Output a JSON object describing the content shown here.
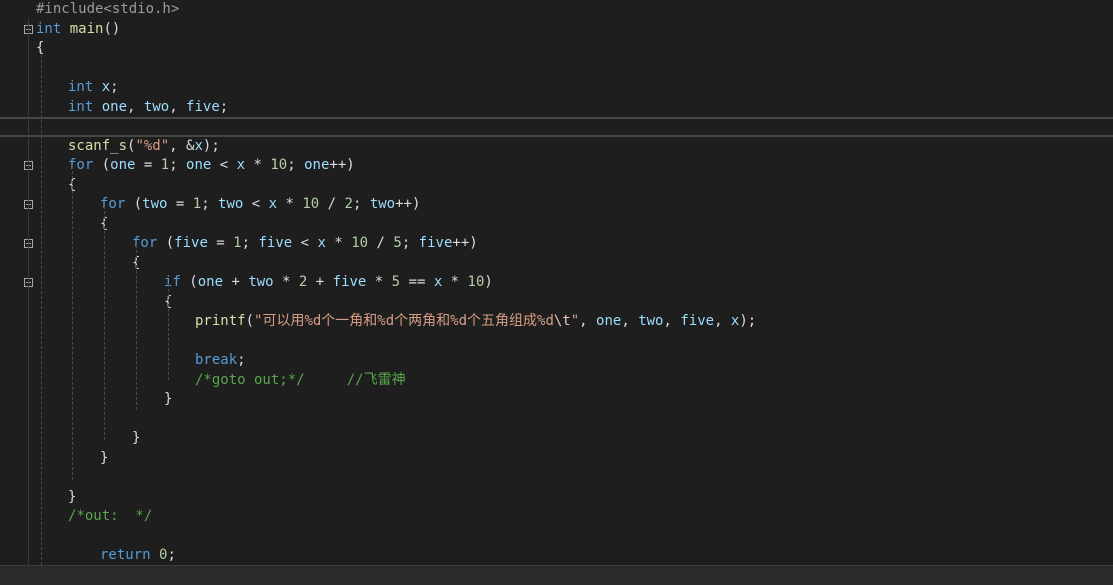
{
  "editor": {
    "lines": [
      {
        "fold": false,
        "indent": 36,
        "tokens": [
          {
            "t": "#include<stdio.h>",
            "c": "pp"
          }
        ]
      },
      {
        "fold": true,
        "indent": 36,
        "tokens": [
          {
            "t": "int",
            "c": "kw"
          },
          {
            "t": " "
          },
          {
            "t": "main",
            "c": "fn"
          },
          {
            "t": "()"
          }
        ]
      },
      {
        "fold": false,
        "indent": 36,
        "tokens": [
          {
            "t": "{"
          }
        ]
      },
      {
        "fold": false,
        "indent": 68,
        "tokens": []
      },
      {
        "fold": false,
        "indent": 68,
        "tokens": [
          {
            "t": "int",
            "c": "kw"
          },
          {
            "t": " "
          },
          {
            "t": "x",
            "c": "id"
          },
          {
            "t": ";"
          }
        ]
      },
      {
        "fold": false,
        "indent": 68,
        "tokens": [
          {
            "t": "int",
            "c": "kw"
          },
          {
            "t": " "
          },
          {
            "t": "one",
            "c": "id"
          },
          {
            "t": ", "
          },
          {
            "t": "two",
            "c": "id"
          },
          {
            "t": ", "
          },
          {
            "t": "five",
            "c": "id"
          },
          {
            "t": ";"
          }
        ]
      },
      {
        "fold": false,
        "indent": 68,
        "current": true,
        "tokens": []
      },
      {
        "fold": false,
        "indent": 68,
        "tokens": [
          {
            "t": "scanf_s",
            "c": "fn"
          },
          {
            "t": "("
          },
          {
            "t": "\"%d\"",
            "c": "str"
          },
          {
            "t": ", &"
          },
          {
            "t": "x",
            "c": "id"
          },
          {
            "t": ");"
          }
        ]
      },
      {
        "fold": true,
        "indent": 68,
        "tokens": [
          {
            "t": "for",
            "c": "kw"
          },
          {
            "t": " ("
          },
          {
            "t": "one",
            "c": "id"
          },
          {
            "t": " = "
          },
          {
            "t": "1",
            "c": "num"
          },
          {
            "t": "; "
          },
          {
            "t": "one",
            "c": "id"
          },
          {
            "t": " < "
          },
          {
            "t": "x",
            "c": "id"
          },
          {
            "t": " * "
          },
          {
            "t": "10",
            "c": "num"
          },
          {
            "t": "; "
          },
          {
            "t": "one",
            "c": "id"
          },
          {
            "t": "++)"
          }
        ]
      },
      {
        "fold": false,
        "indent": 68,
        "tokens": [
          {
            "t": "{"
          }
        ]
      },
      {
        "fold": true,
        "indent": 100,
        "tokens": [
          {
            "t": "for",
            "c": "kw"
          },
          {
            "t": " ("
          },
          {
            "t": "two",
            "c": "id"
          },
          {
            "t": " = "
          },
          {
            "t": "1",
            "c": "num"
          },
          {
            "t": "; "
          },
          {
            "t": "two",
            "c": "id"
          },
          {
            "t": " < "
          },
          {
            "t": "x",
            "c": "id"
          },
          {
            "t": " * "
          },
          {
            "t": "10",
            "c": "num"
          },
          {
            "t": " / "
          },
          {
            "t": "2",
            "c": "num"
          },
          {
            "t": "; "
          },
          {
            "t": "two",
            "c": "id"
          },
          {
            "t": "++)"
          }
        ]
      },
      {
        "fold": false,
        "indent": 100,
        "tokens": [
          {
            "t": "{"
          }
        ]
      },
      {
        "fold": true,
        "indent": 132,
        "tokens": [
          {
            "t": "for",
            "c": "kw"
          },
          {
            "t": " ("
          },
          {
            "t": "five",
            "c": "id"
          },
          {
            "t": " = "
          },
          {
            "t": "1",
            "c": "num"
          },
          {
            "t": "; "
          },
          {
            "t": "five",
            "c": "id"
          },
          {
            "t": " < "
          },
          {
            "t": "x",
            "c": "id"
          },
          {
            "t": " * "
          },
          {
            "t": "10",
            "c": "num"
          },
          {
            "t": " / "
          },
          {
            "t": "5",
            "c": "num"
          },
          {
            "t": "; "
          },
          {
            "t": "five",
            "c": "id"
          },
          {
            "t": "++)"
          }
        ]
      },
      {
        "fold": false,
        "indent": 132,
        "tokens": [
          {
            "t": "{"
          }
        ]
      },
      {
        "fold": true,
        "indent": 164,
        "tokens": [
          {
            "t": "if",
            "c": "kw"
          },
          {
            "t": " ("
          },
          {
            "t": "one",
            "c": "id"
          },
          {
            "t": " + "
          },
          {
            "t": "two",
            "c": "id"
          },
          {
            "t": " * "
          },
          {
            "t": "2",
            "c": "num"
          },
          {
            "t": " + "
          },
          {
            "t": "five",
            "c": "id"
          },
          {
            "t": " * "
          },
          {
            "t": "5",
            "c": "num"
          },
          {
            "t": " == "
          },
          {
            "t": "x",
            "c": "id"
          },
          {
            "t": " * "
          },
          {
            "t": "10",
            "c": "num"
          },
          {
            "t": ")"
          }
        ]
      },
      {
        "fold": false,
        "indent": 164,
        "tokens": [
          {
            "t": "{"
          }
        ]
      },
      {
        "fold": false,
        "indent": 195,
        "tokens": [
          {
            "t": "printf",
            "c": "fn"
          },
          {
            "t": "("
          },
          {
            "t": "\"可以用%d个一角和%d个两角和%d个五角组成%d",
            "c": "str"
          },
          {
            "t": "\\t",
            "c": "esc"
          },
          {
            "t": "\"",
            "c": "str"
          },
          {
            "t": ", "
          },
          {
            "t": "one",
            "c": "id"
          },
          {
            "t": ", "
          },
          {
            "t": "two",
            "c": "id"
          },
          {
            "t": ", "
          },
          {
            "t": "five",
            "c": "id"
          },
          {
            "t": ", "
          },
          {
            "t": "x",
            "c": "id"
          },
          {
            "t": ");"
          }
        ]
      },
      {
        "fold": false,
        "indent": 195,
        "tokens": []
      },
      {
        "fold": false,
        "indent": 195,
        "tokens": [
          {
            "t": "break",
            "c": "kw"
          },
          {
            "t": ";"
          }
        ]
      },
      {
        "fold": false,
        "indent": 195,
        "tokens": [
          {
            "t": "/*goto out;*/     //飞雷神",
            "c": "cm"
          }
        ]
      },
      {
        "fold": false,
        "indent": 164,
        "tokens": [
          {
            "t": "}"
          }
        ]
      },
      {
        "fold": false,
        "indent": 164,
        "tokens": []
      },
      {
        "fold": false,
        "indent": 132,
        "tokens": [
          {
            "t": "}"
          }
        ]
      },
      {
        "fold": false,
        "indent": 100,
        "tokens": [
          {
            "t": "}"
          }
        ]
      },
      {
        "fold": false,
        "indent": 100,
        "tokens": []
      },
      {
        "fold": false,
        "indent": 68,
        "tokens": [
          {
            "t": "}"
          }
        ]
      },
      {
        "fold": false,
        "indent": 68,
        "tokens": [
          {
            "t": "/*out:  */",
            "c": "cm"
          }
        ]
      },
      {
        "fold": false,
        "indent": 100,
        "tokens": []
      },
      {
        "fold": false,
        "indent": 100,
        "tokens": [
          {
            "t": "return",
            "c": "kw"
          },
          {
            "t": " "
          },
          {
            "t": "0",
            "c": "num"
          },
          {
            "t": ";"
          }
        ]
      },
      {
        "fold": false,
        "indent": 68,
        "tokens": [
          {
            "t": "}"
          }
        ]
      }
    ]
  }
}
